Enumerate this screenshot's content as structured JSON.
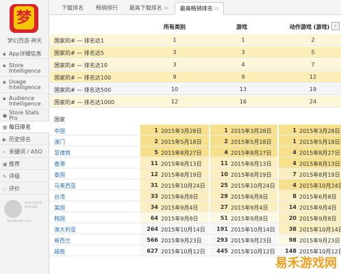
{
  "sidebar": {
    "app_icon_glyph": "梦",
    "app_name": "梦幻西游·神天",
    "items": [
      {
        "label": "App详细信息",
        "icon": "info-icon",
        "glyph": "▪"
      },
      {
        "label": "Store Intelligence",
        "icon": "store-intelligence-icon",
        "glyph": "▪"
      },
      {
        "label": "Usage Intelligence",
        "icon": "usage-intelligence-icon",
        "glyph": "▪"
      },
      {
        "label": "Audience Intelligence",
        "icon": "audience-intelligence-icon",
        "glyph": "▪"
      },
      {
        "label": "Store Stats Pro",
        "icon": "stats-icon",
        "glyph": "●"
      },
      {
        "label": "每日排名",
        "icon": "calendar-icon",
        "glyph": "▦"
      },
      {
        "label": "历史排名",
        "icon": "history-icon",
        "glyph": "▶"
      },
      {
        "label": "关键词 / ASO",
        "icon": "keyword-icon",
        "glyph": "⌕"
      },
      {
        "label": "推荐",
        "icon": "recommend-icon",
        "glyph": "▣"
      },
      {
        "label": "评级",
        "icon": "rating-icon",
        "glyph": "✎"
      },
      {
        "label": "评价",
        "icon": "review-icon",
        "glyph": "◌"
      }
    ],
    "logo_text": "THE NOTE BEHIND",
    "logo_sub": "AppAnnie.com"
  },
  "tabs": [
    {
      "label": "下载排名"
    },
    {
      "label": "畅销排行"
    },
    {
      "label": "最高下载排名",
      "marker": "⊙"
    },
    {
      "label": "最高畅销排名",
      "marker": "⊙"
    }
  ],
  "columns": [
    "所有类别",
    "游戏",
    "动作游戏 (游戏)"
  ],
  "nav_arrow": "›",
  "summary_rows": [
    {
      "label": "国家的# — 排名达1",
      "values": [
        "1",
        "1",
        "2"
      ]
    },
    {
      "label": "国家的# — 排名达5",
      "values": [
        "3",
        "3",
        "5"
      ]
    },
    {
      "label": "国家的# — 排名达10",
      "values": [
        "3",
        "4",
        "7"
      ]
    },
    {
      "label": "国家的# — 排名达100",
      "values": [
        "9",
        "9",
        "12"
      ]
    },
    {
      "label": "国家的# — 排名达500",
      "values": [
        "10",
        "13",
        "19"
      ]
    },
    {
      "label": "国家的# — 排名达1000",
      "values": [
        "12",
        "16",
        "24"
      ]
    }
  ],
  "country_section_label": "国家",
  "countries": [
    {
      "name": "中国",
      "cells": [
        [
          "1",
          "2015年3月28日"
        ],
        [
          "1",
          "2015年3月28日"
        ],
        [
          "1",
          "2015年3月28日"
        ]
      ]
    },
    {
      "name": "澳门",
      "cells": [
        [
          "2",
          "2015年5月18日"
        ],
        [
          "2",
          "2015年5月18日"
        ],
        [
          "1",
          "2015年5月18日"
        ]
      ]
    },
    {
      "name": "菲律宾",
      "cells": [
        [
          "5",
          "2015年8月27日"
        ],
        [
          "4",
          "2015年8月27日"
        ],
        [
          "4",
          "2015年8月27日"
        ]
      ]
    },
    {
      "name": "香港",
      "cells": [
        [
          "11",
          "2015年8月13日"
        ],
        [
          "11",
          "2015年8月13日"
        ],
        [
          "4",
          "2015年8月13日"
        ]
      ]
    },
    {
      "name": "泰国",
      "cells": [
        [
          "12",
          "2015年8月19日"
        ],
        [
          "10",
          "2015年8月19日"
        ],
        [
          "7",
          "2015年8月19日"
        ]
      ]
    },
    {
      "name": "马来西亚",
      "cells": [
        [
          "31",
          "2015年10月24日"
        ],
        [
          "25",
          "2015年10月24日"
        ],
        [
          "4",
          "2015年10月24日"
        ]
      ]
    },
    {
      "name": "台湾",
      "cells": [
        [
          "33",
          "2015年6月8日"
        ],
        [
          "29",
          "2015年6月8日"
        ],
        [
          "8",
          "2015年6月8日"
        ]
      ]
    },
    {
      "name": "美国",
      "cells": [
        [
          "34",
          "2015年9月4日"
        ],
        [
          "27",
          "2015年9月4日"
        ],
        [
          "14",
          "2015年9月4日"
        ]
      ]
    },
    {
      "name": "韩国",
      "cells": [
        [
          "64",
          "2015年9月8日"
        ],
        [
          "51",
          "2015年9月8日"
        ],
        [
          "20",
          "2015年9月8日"
        ]
      ]
    },
    {
      "name": "澳大利亚",
      "cells": [
        [
          "264",
          "2015年10月14日"
        ],
        [
          "191",
          "2015年10月14日"
        ],
        [
          "38",
          "2015年10月14日"
        ]
      ]
    },
    {
      "name": "新西兰",
      "cells": [
        [
          "566",
          "2015年9月23日"
        ],
        [
          "293",
          "2015年9月23日"
        ],
        [
          "98",
          "2015年9月23日"
        ]
      ]
    },
    {
      "name": "越南",
      "cells": [
        [
          "627",
          "2015年10月12日"
        ],
        [
          "445",
          "2015年10月12日"
        ],
        [
          "148",
          "2015年10月12日"
        ]
      ]
    }
  ],
  "site_watermark": "易禾游戏网",
  "colors": {
    "rank_top": "#f7e08c",
    "rank_mid": "#fbeec0",
    "rank_low": "#fdf8e4",
    "rank_none": "#f7f7f7",
    "link": "#2a6fb5"
  }
}
